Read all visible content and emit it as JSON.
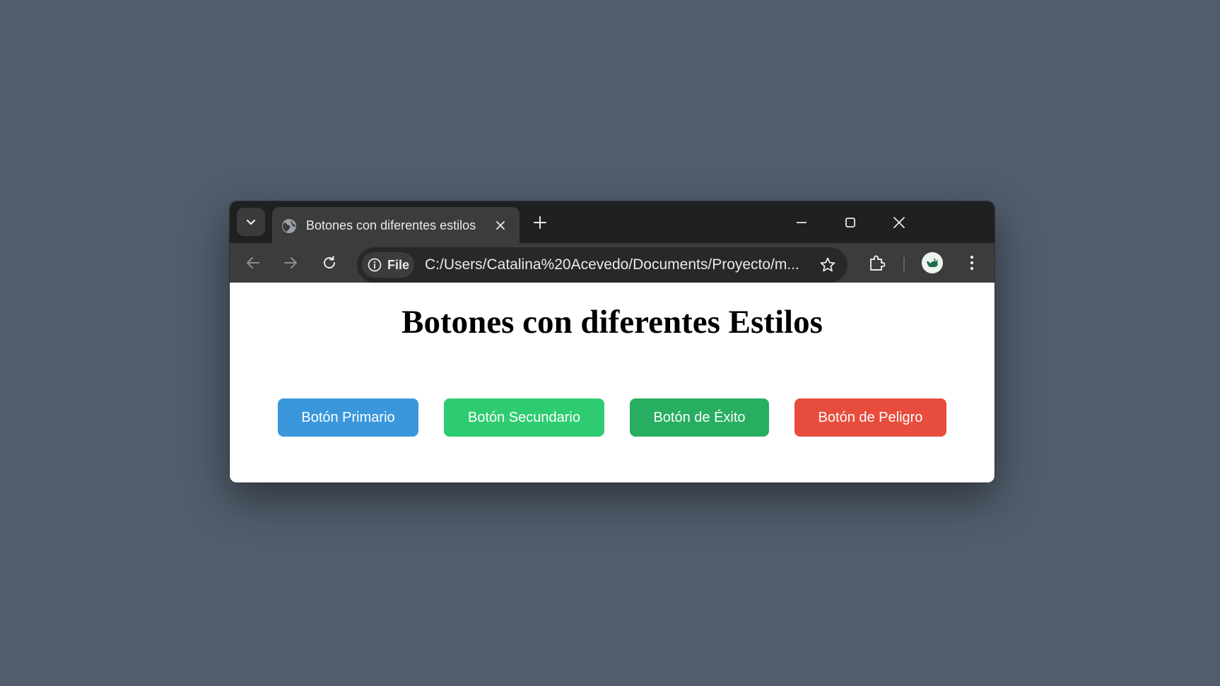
{
  "browser": {
    "tab": {
      "title": "Botones con diferentes estilos",
      "favicon": "globe-icon"
    },
    "address_bar": {
      "chip_label": "File",
      "url": "C:/Users/Catalina%20Acevedo/Documents/Proyecto/m..."
    }
  },
  "page": {
    "heading": "Botones con diferentes Estilos",
    "buttons": [
      {
        "label": "Botón Primario",
        "color": "#3a97dc"
      },
      {
        "label": "Botón Secundario",
        "color": "#2ecc71"
      },
      {
        "label": "Botón de Éxito",
        "color": "#27ae60"
      },
      {
        "label": "Botón de Peligro",
        "color": "#e74c3c"
      }
    ]
  },
  "colors": {
    "desktop": "#515d6c",
    "titlebar": "#1f2020",
    "toolbar": "#3c3c3c"
  }
}
